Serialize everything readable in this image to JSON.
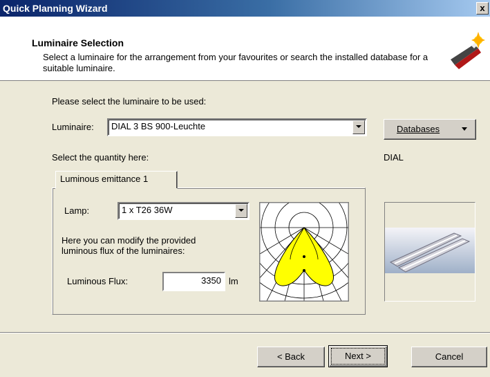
{
  "window": {
    "title": "Quick Planning Wizard",
    "close_label": "x"
  },
  "header": {
    "title": "Luminaire Selection",
    "description": "Select a luminaire for the arrangement from your favourites or search the installed database for a suitable luminaire."
  },
  "luminaire": {
    "prompt": "Please select the luminaire to be used:",
    "label": "Luminaire:",
    "selected": "DIAL 3 BS 900-Leuchte",
    "databases_label": "Databases",
    "manufacturer": "DIAL"
  },
  "quantity": {
    "prompt": "Select the quantity here:",
    "tab_label": "Luminous emittance 1",
    "lamp_label": "Lamp:",
    "lamp_selected": "1 x T26 36W",
    "modify_text": "Here you can modify the provided luminous flux of the luminaires:",
    "flux_label": "Luminous Flux:",
    "flux_value": "3350",
    "flux_unit": "lm"
  },
  "footer": {
    "back_label": "< Back",
    "next_label": "Next >",
    "cancel_label": "Cancel"
  },
  "colors": {
    "title_bar": "#0a246a",
    "dialog_bg": "#ece9d8",
    "ldc_fill": "#ffff00"
  }
}
